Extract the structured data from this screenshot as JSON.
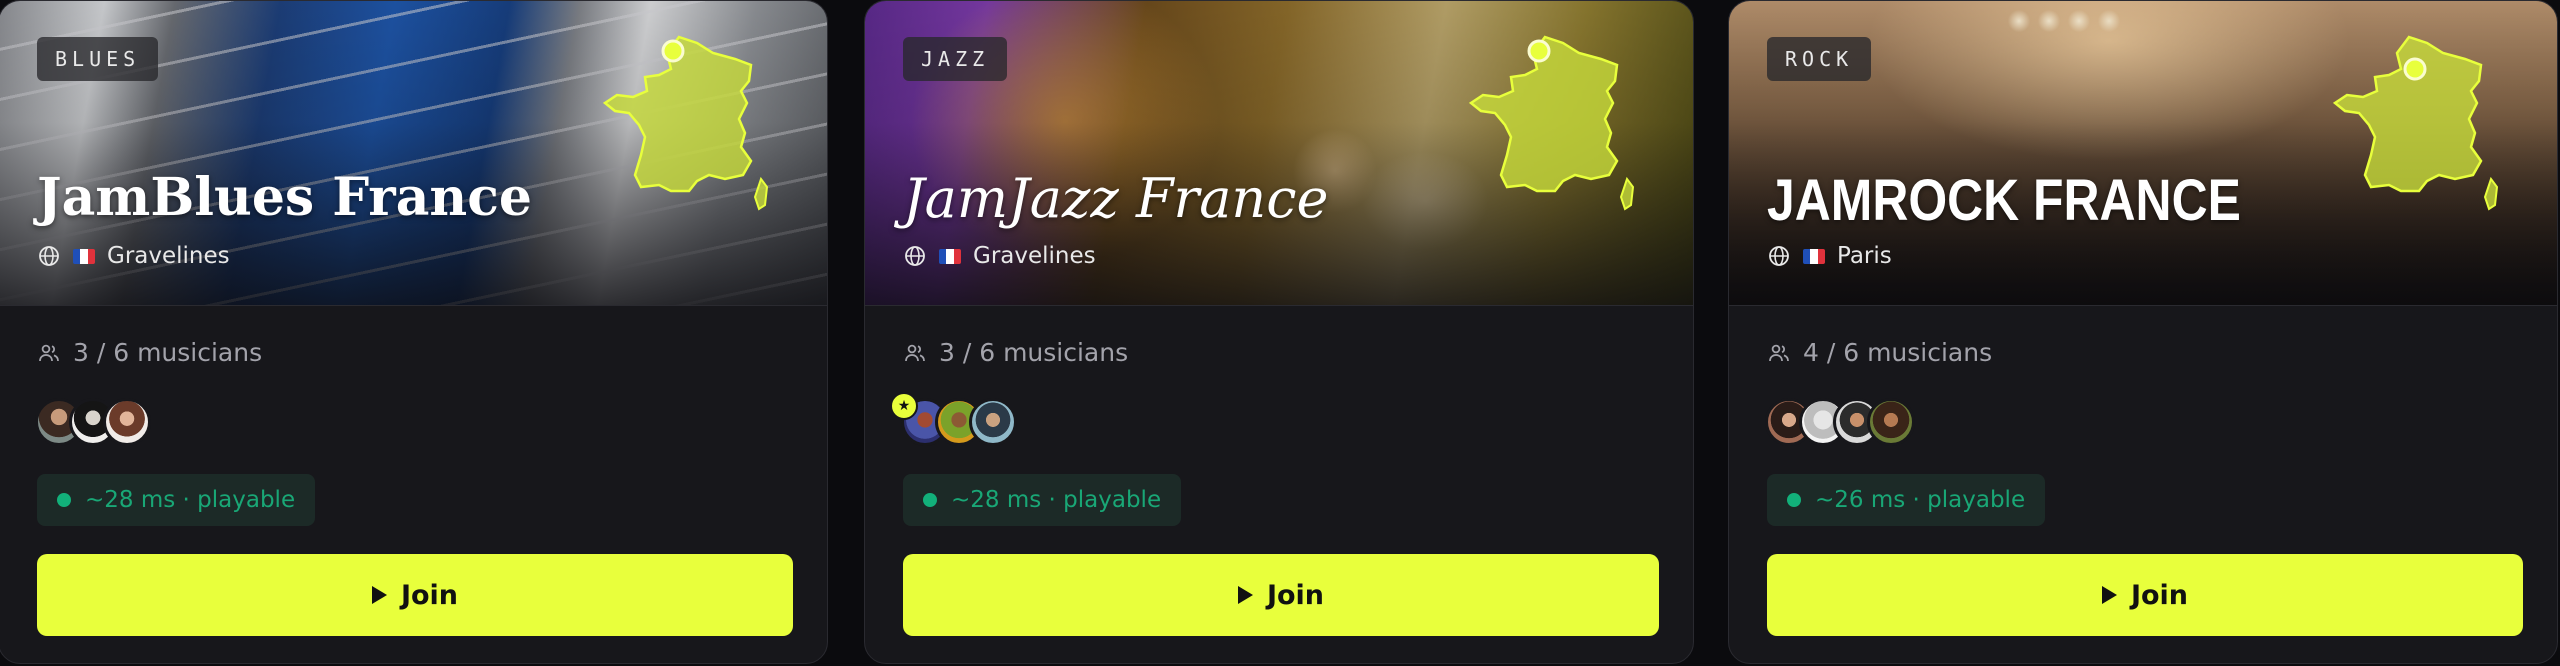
{
  "colors": {
    "accent": "#e8ff3c",
    "card": "#17171b",
    "status": "#12b07a"
  },
  "icons": {
    "musicians": "users-icon",
    "location": "globe-icon",
    "join": "play-icon",
    "host": "star-icon"
  },
  "cards": [
    {
      "genre": "BLUES",
      "title": "JamBlues France",
      "flag": "🇫🇷",
      "city": "Gravelines",
      "musicians": "3 / 6 musicians",
      "latency": "~28 ms · playable",
      "join_label": "Join"
    },
    {
      "genre": "JAZZ",
      "title": "JamJazz France",
      "flag": "🇫🇷",
      "city": "Gravelines",
      "musicians": "3 / 6 musicians",
      "latency": "~28 ms · playable",
      "join_label": "Join"
    },
    {
      "genre": "ROCK",
      "title": "JAMROCK FRANCE",
      "flag": "🇫🇷",
      "city": "Paris",
      "musicians": "4 / 6 musicians",
      "latency": "~26 ms · playable",
      "join_label": "Join"
    }
  ]
}
